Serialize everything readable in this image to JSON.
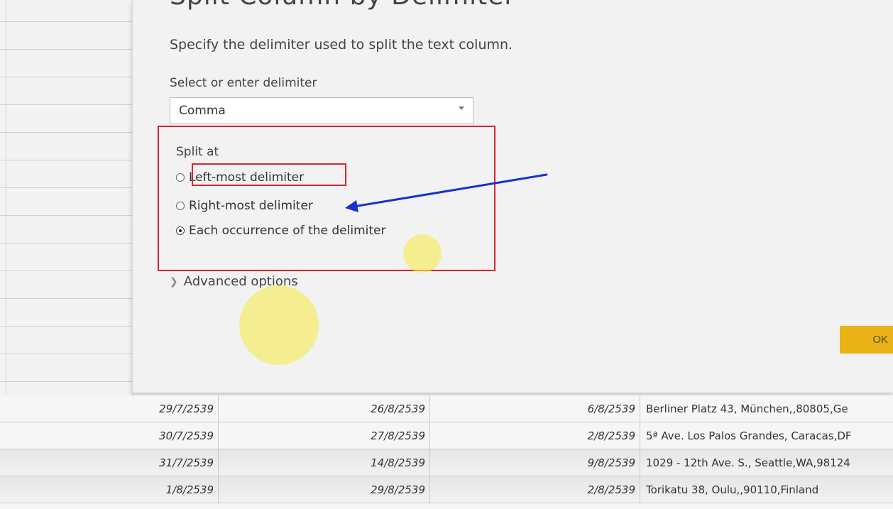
{
  "dialog": {
    "title": "Split Column by Delimiter",
    "description": "Specify the delimiter used to split the text column.",
    "select_label": "Select or enter delimiter",
    "delimiter_value": "Comma",
    "split_at_label": "Split at",
    "options": [
      {
        "label": "Left-most delimiter",
        "checked": false
      },
      {
        "label": "Right-most delimiter",
        "checked": false
      },
      {
        "label": "Each occurrence of the delimiter",
        "checked": true
      }
    ],
    "advanced_label": "Advanced options",
    "ok_label": "OK"
  },
  "colors": {
    "highlight_box": "#d8262c",
    "arrow": "#1a2fd0",
    "cursor_dot": "#f5eb5a",
    "ok_button": "#e9b318"
  },
  "table": {
    "rows": [
      {
        "col1": "29/7/2539",
        "col2": "26/8/2539",
        "col3": "6/8/2539",
        "col4": "Berliner Platz 43, München,,80805,Ge"
      },
      {
        "col1": "30/7/2539",
        "col2": "27/8/2539",
        "col3": "2/8/2539",
        "col4": "5ª Ave. Los Palos Grandes, Caracas,DF"
      },
      {
        "col1": "31/7/2539",
        "col2": "14/8/2539",
        "col3": "9/8/2539",
        "col4": "1029 - 12th Ave. S., Seattle,WA,98124"
      },
      {
        "col1": "1/8/2539",
        "col2": "29/8/2539",
        "col3": "2/8/2539",
        "col4": "Torikatu 38, Oulu,,90110,Finland"
      }
    ]
  }
}
